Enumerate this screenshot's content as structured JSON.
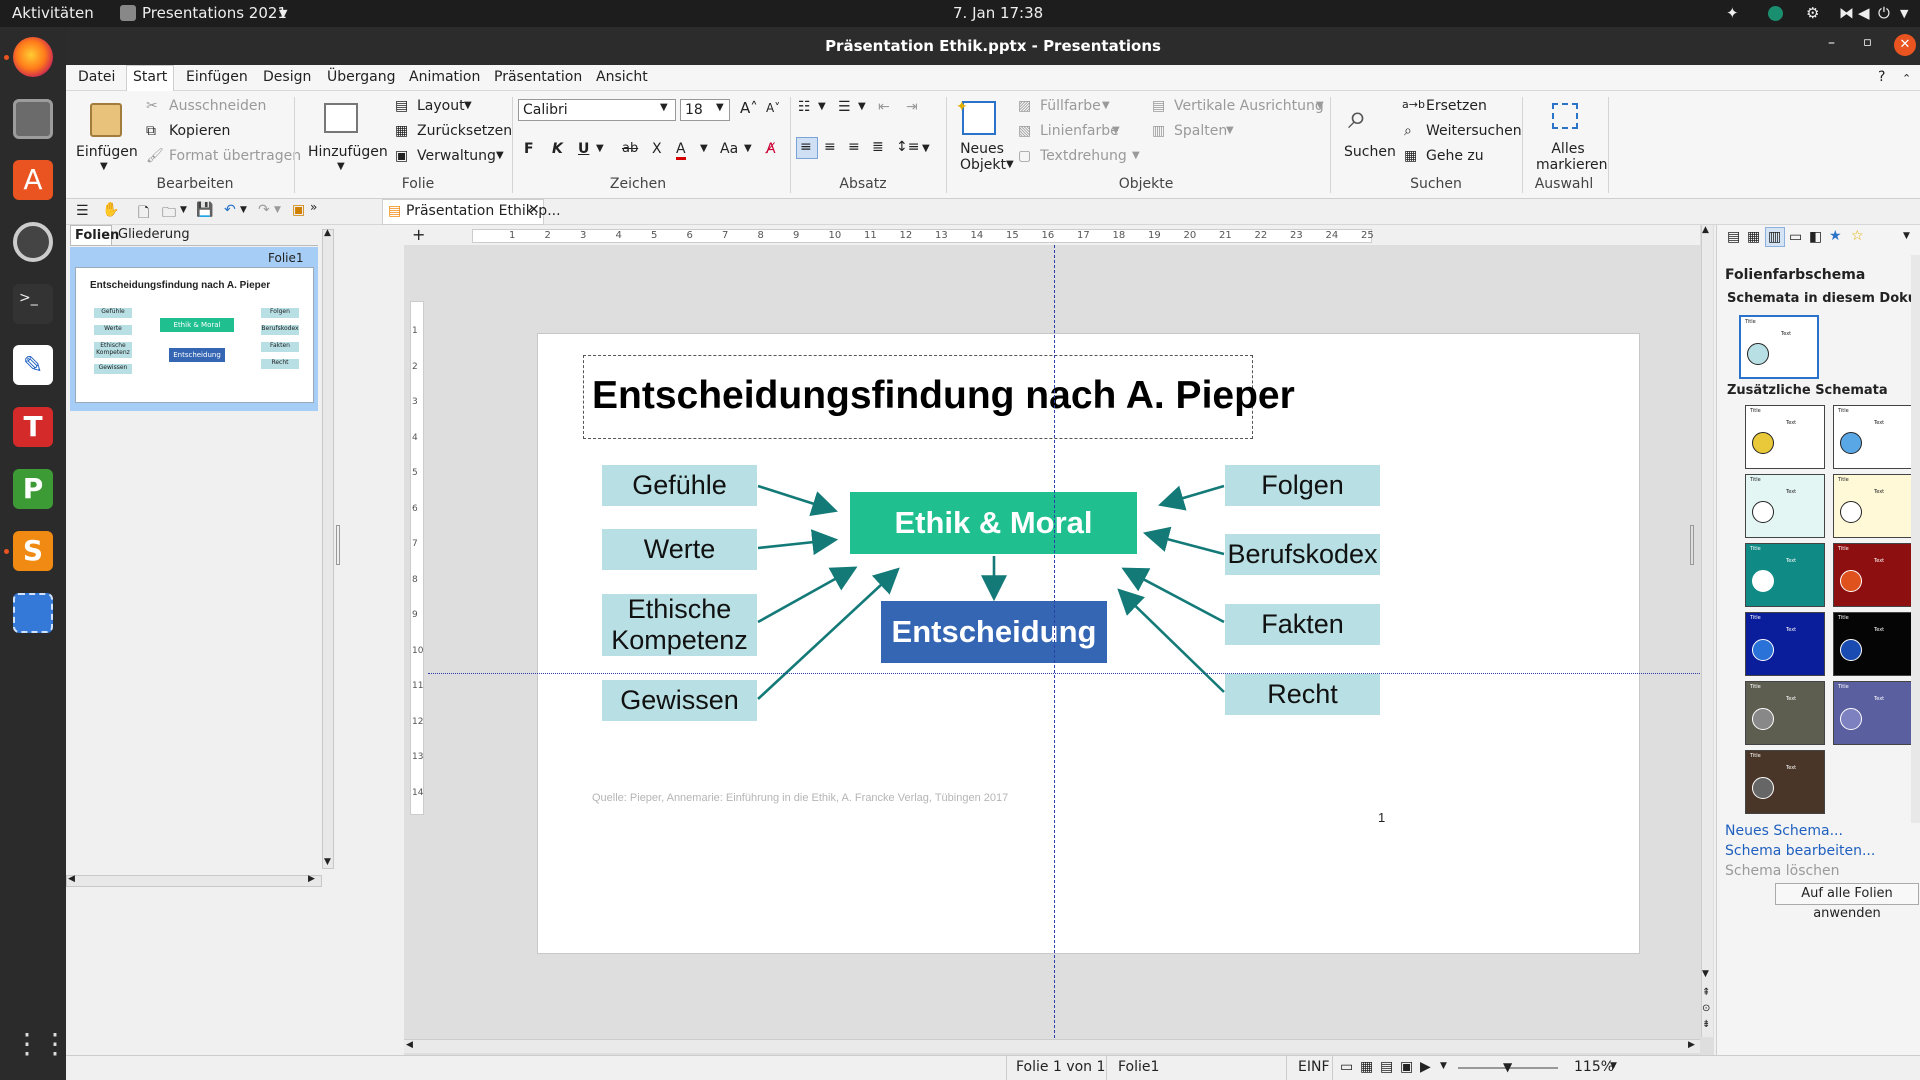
{
  "topbar": {
    "activities": "Aktivitäten",
    "app_name": "Presentations 2021",
    "clock": "7. Jan  17:38"
  },
  "window": {
    "title": "Präsentation Ethik.pptx - Presentations"
  },
  "menu": [
    "Datei",
    "Start",
    "Einfügen",
    "Design",
    "Übergang",
    "Animation",
    "Präsentation",
    "Ansicht"
  ],
  "ribbon": {
    "bearbeiten": {
      "paste": "Einfügen",
      "cut": "Ausschneiden",
      "copy": "Kopieren",
      "format": "Format übertragen",
      "group": "Bearbeiten"
    },
    "folie": {
      "add": "Hinzufügen",
      "layout": "Layout",
      "reset": "Zurücksetzen",
      "manage": "Verwaltung",
      "group": "Folie"
    },
    "zeichen": {
      "font": "Calibri",
      "size": "18",
      "group": "Zeichen",
      "bold": "F",
      "italic": "K",
      "underline": "U",
      "strike": "ab",
      "clear": "X",
      "color": "A",
      "case": "Aa"
    },
    "absatz": {
      "group": "Absatz"
    },
    "objekte": {
      "new": "Neues Objekt",
      "fill": "Füllfarbe",
      "line": "Linienfarbe",
      "textdir": "Textdrehung",
      "valign": "Vertikale Ausrichtung",
      "columns": "Spalten",
      "group": "Objekte"
    },
    "suchen": {
      "search": "Suchen",
      "replace": "Ersetzen",
      "next": "Weitersuchen",
      "goto": "Gehe zu",
      "group": "Suchen"
    },
    "auswahl": {
      "all": "Alles markieren",
      "group": "Auswahl"
    }
  },
  "doc_tab": "Präsentation Ethik.p...",
  "panel_tabs": [
    "Folien",
    "Gliederung"
  ],
  "thumb_label": "Folie1",
  "ruler_h": [
    "1",
    "2",
    "3",
    "4",
    "5",
    "6",
    "7",
    "8",
    "9",
    "10",
    "11",
    "12",
    "13",
    "14",
    "15",
    "16",
    "17",
    "18",
    "19",
    "20",
    "21",
    "22",
    "23",
    "24",
    "25"
  ],
  "ruler_v": [
    "1",
    "2",
    "3",
    "4",
    "5",
    "6",
    "7",
    "8",
    "9",
    "10",
    "11",
    "12",
    "13",
    "14"
  ],
  "slide": {
    "title": "Entscheidungsfindung nach A. Pieper",
    "center": "Ethik & Moral",
    "decision": "Entscheidung",
    "left": [
      "Gefühle",
      "Werte",
      "Ethische Kompetenz",
      "Gewissen"
    ],
    "right": [
      "Folgen",
      "Berufskodex",
      "Fakten",
      "Recht"
    ],
    "source": "Quelle: Pieper, Annemarie: Einführung in die Ethik, A. Francke Verlag, Tübingen 2017",
    "number": "1",
    "colors": {
      "center": "#1fbf8f",
      "decision": "#3566b3",
      "label": "#b7dfe4",
      "arrow": "#137a78"
    }
  },
  "sidebar": {
    "heading": "Folienfarbschema",
    "doc_schemes": "Schemata in diesem Dokument",
    "extra_schemes": "Zusätzliche Schemata",
    "scheme_title": "Title",
    "scheme_text": "Text",
    "new": "Neues Schema...",
    "edit": "Schema bearbeiten...",
    "delete": "Schema löschen",
    "apply": "Auf alle Folien anwenden"
  },
  "status": {
    "slide": "Folie 1 von 1",
    "name": "Folie1",
    "mode": "EINF",
    "zoom": "115%"
  }
}
